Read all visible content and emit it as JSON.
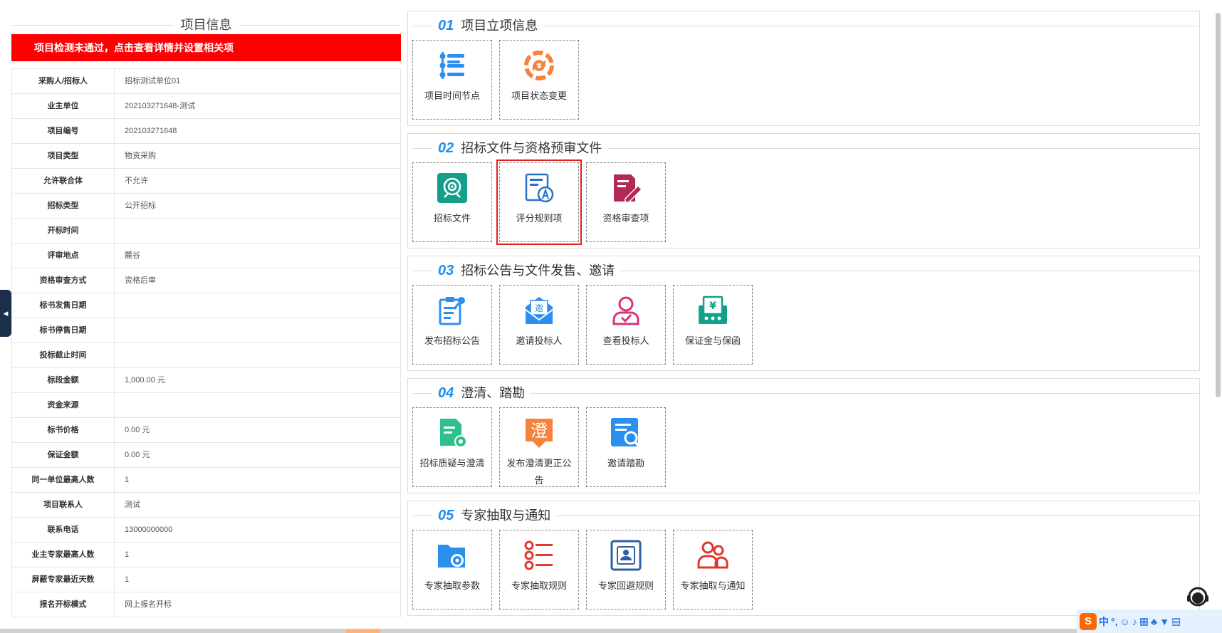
{
  "left_panel": {
    "title": "项目信息",
    "alert": "项目检测未通过，点击查看详情并设置相关项",
    "rows": [
      {
        "label": "采购人/招标人",
        "value": "招标测试单位01"
      },
      {
        "label": "业主单位",
        "value": "202103271648-测试"
      },
      {
        "label": "项目编号",
        "value": "202103271648"
      },
      {
        "label": "项目类型",
        "value": "物资采购"
      },
      {
        "label": "允许联合体",
        "value": "不允许"
      },
      {
        "label": "招标类型",
        "value": "公开招标"
      },
      {
        "label": "开标时间",
        "value": ""
      },
      {
        "label": "评审地点",
        "value": "麓谷"
      },
      {
        "label": "资格审查方式",
        "value": "资格后审"
      },
      {
        "label": "标书发售日期",
        "value": ""
      },
      {
        "label": "标书停售日期",
        "value": ""
      },
      {
        "label": "投标截止时间",
        "value": ""
      },
      {
        "label": "标段金额",
        "value": "1,000.00 元"
      },
      {
        "label": "资金来源",
        "value": ""
      },
      {
        "label": "标书价格",
        "value": "0.00 元"
      },
      {
        "label": "保证金额",
        "value": "0.00 元"
      },
      {
        "label": "同一单位最高人数",
        "value": "1"
      },
      {
        "label": "项目联系人",
        "value": "测试"
      },
      {
        "label": "联系电话",
        "value": "13000000000"
      },
      {
        "label": "业主专家最高人数",
        "value": "1"
      },
      {
        "label": "屏蔽专家最近天数",
        "value": "1"
      },
      {
        "label": "报名开标模式",
        "value": "网上报名开标"
      }
    ]
  },
  "sections": [
    {
      "num": "01",
      "title": "项目立项信息",
      "tiles": [
        {
          "label": "项目时间节点",
          "icon": "timeline-list-icon",
          "color": "#2b8ff0"
        },
        {
          "label": "项目状态变更",
          "icon": "status-change-icon",
          "color": "#f5833c"
        }
      ]
    },
    {
      "num": "02",
      "title": "招标文件与资格预审文件",
      "tiles": [
        {
          "label": "招标文件",
          "icon": "target-document-icon",
          "color": "#12a08a"
        },
        {
          "label": "评分规则项",
          "icon": "scoring-rules-icon",
          "color": "#2672c9",
          "selected": true
        },
        {
          "label": "资格审查项",
          "icon": "qualification-edit-icon",
          "color": "#b02a54"
        }
      ]
    },
    {
      "num": "03",
      "title": "招标公告与文件发售、邀请",
      "tiles": [
        {
          "label": "发布招标公告",
          "icon": "publish-notice-icon",
          "color": "#2b8ff0"
        },
        {
          "label": "邀请投标人",
          "icon": "invitation-envelope-icon",
          "color": "#2b8ff0",
          "badge": "邀"
        },
        {
          "label": "查看投标人",
          "icon": "bidder-person-icon",
          "color": "#d8337a"
        },
        {
          "label": "保证金与保函",
          "icon": "deposit-guarantee-icon",
          "color": "#12a08a",
          "badge": "¥"
        }
      ]
    },
    {
      "num": "04",
      "title": "澄清、踏勘",
      "tiles": [
        {
          "label": "招标质疑与澄清",
          "icon": "doc-settings-icon",
          "color": "#2fbf8a"
        },
        {
          "label": "发布澄清更正公告",
          "icon": "clarify-badge-icon",
          "color": "#f5833c",
          "badge": "澄"
        },
        {
          "label": "邀请踏勘",
          "icon": "doc-search-icon",
          "color": "#2b8ff0"
        }
      ]
    },
    {
      "num": "05",
      "title": "专家抽取与通知",
      "tiles": [
        {
          "label": "专家抽取参数",
          "icon": "folder-gear-icon",
          "color": "#2b8ff0"
        },
        {
          "label": "专家抽取规则",
          "icon": "rule-list-icon",
          "color": "#e0382f"
        },
        {
          "label": "专家回避规则",
          "icon": "avoid-frame-icon",
          "color": "#2f5fa8"
        },
        {
          "label": "专家抽取与通知",
          "icon": "expert-group-icon",
          "color": "#e0382f"
        }
      ]
    }
  ],
  "ime": {
    "lang": "中"
  }
}
